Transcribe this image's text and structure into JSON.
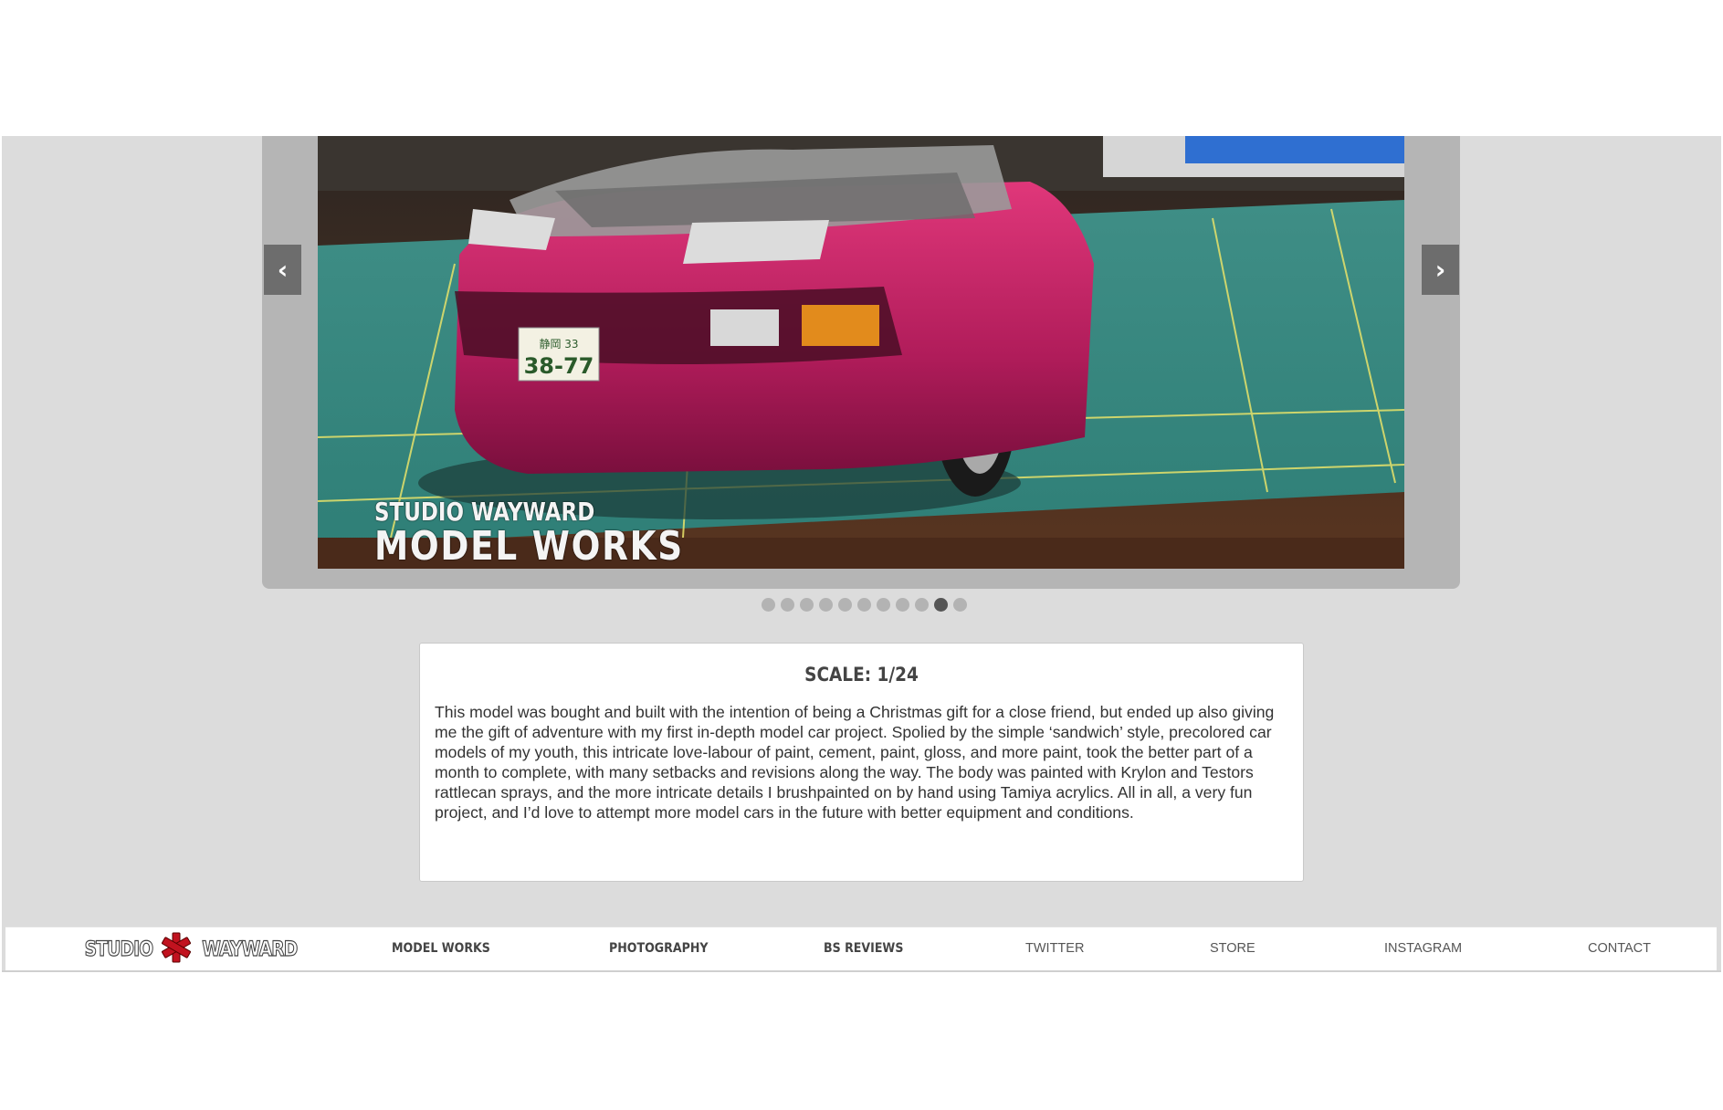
{
  "slider": {
    "prev_label": "‹",
    "next_label": "›",
    "caption_line1": "STUDIO WAYWARD",
    "caption_line2": "MODEL WORKS",
    "slide_count": 11,
    "active_slide": 10
  },
  "card": {
    "heading": "SCALE: 1/24",
    "body": "This model was bought and built with the intention of being a Christmas gift for a close friend, but ended up also giving me the gift of adventure with my first in-depth model car project. Spolied by the simple ‘sandwich’ style, precolored car models of my youth, this intricate love-labour of paint, cement, paint, gloss, and more paint, took the better part of a month to complete, with many setbacks and revisions along the way. The body was painted with Krylon and Testors rattlecan sprays, and the more intricate details I brushpainted on by hand using Tamiya acrylics. All in all, a very fun project, and I’d love to attempt more model cars in the future with better equipment and conditions."
  },
  "nav": {
    "logo_left": "STUDIO",
    "logo_right": "WAYWARD",
    "items": [
      "MODEL WORKS",
      "PHOTOGRAPHY",
      "BS REVIEWS",
      "TWITTER",
      "STORE",
      "INSTAGRAM",
      "CONTACT"
    ]
  },
  "colors": {
    "frame_bg": "#dcdcdc",
    "slider_bg": "#b5b5b5",
    "arrow_bg": "#6d6d6d",
    "dot_inactive": "#b3b3b3",
    "dot_active": "#555555",
    "logo_star": "#c1121f"
  }
}
